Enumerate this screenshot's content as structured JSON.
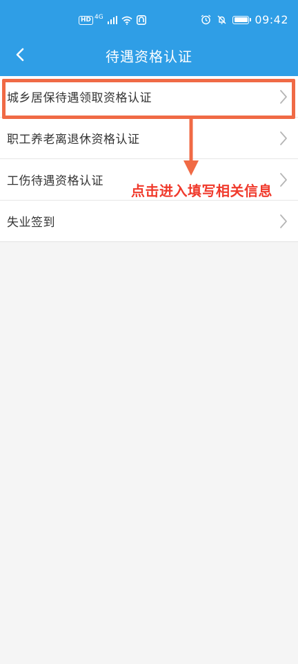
{
  "status_bar": {
    "network_badge": "HD",
    "network_type": "4G",
    "time": "09:42",
    "icons": [
      "signal-icon",
      "wifi-icon",
      "app-notification-icon",
      "alarm-icon",
      "mute-icon",
      "battery-icon"
    ]
  },
  "header": {
    "title": "待遇资格认证",
    "back_icon": "chevron-left-icon"
  },
  "menu": {
    "items": [
      {
        "label": "城乡居保待遇领取资格认证"
      },
      {
        "label": "职工养老离退休资格认证"
      },
      {
        "label": "工伤待遇资格认证"
      },
      {
        "label": "失业签到"
      }
    ]
  },
  "annotation": {
    "text": "点击进入填写相关信息"
  },
  "colors": {
    "header_bg": "#2f9ee6",
    "page_bg": "#f5f5f5",
    "annotation": "#f06a45",
    "annotation_text": "#f03a2c"
  }
}
